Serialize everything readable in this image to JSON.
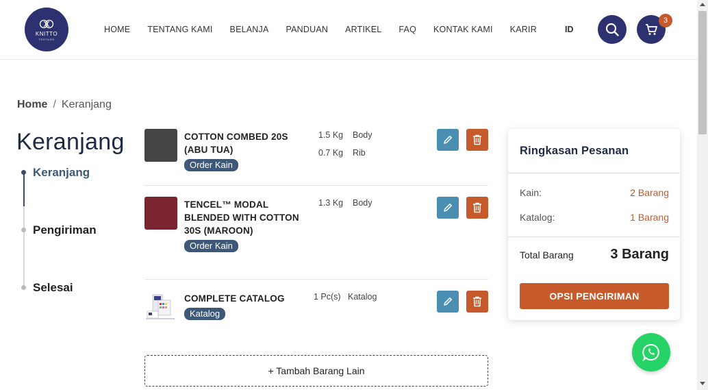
{
  "brand": {
    "name": "KNITTO",
    "sub": "TEXTILES",
    "color": "#2e3170"
  },
  "nav": [
    "HOME",
    "TENTANG KAMI",
    "BELANJA",
    "PANDUAN",
    "ARTIKEL",
    "FAQ",
    "KONTAK KAMI",
    "KARIR"
  ],
  "lang": "ID",
  "cart": {
    "count": "3"
  },
  "breadcrumb": {
    "home": "Home",
    "sep": "/",
    "current": "Keranjang"
  },
  "page_title": "Keranjang",
  "steps": [
    "Keranjang",
    "Pengiriman",
    "Selesai"
  ],
  "items": [
    {
      "name": "COTTON COMBED 20S (ABU TUA)",
      "tag": "Order Kain",
      "swatch": "#444447",
      "qty": [
        {
          "amount": "1.5 Kg",
          "part": "Body"
        },
        {
          "amount": "0.7 Kg",
          "part": "Rib"
        }
      ]
    },
    {
      "name": "TENCEL™ MODAL BLENDED WITH COTTON 30S (MAROON)",
      "tag": "Order Kain",
      "swatch": "#7a2530",
      "qty": [
        {
          "amount": "1.3 Kg",
          "part": "Body"
        }
      ]
    },
    {
      "name": "COMPLETE CATALOG",
      "tag": "Katalog",
      "swatch": "catalog-image",
      "qty": [
        {
          "amount": "1 Pc(s)",
          "part": "Katalog"
        }
      ]
    }
  ],
  "add_more": "+ Tambah Barang Lain",
  "summary": {
    "title": "Ringkasan Pesanan",
    "rows": [
      {
        "label": "Kain:",
        "value": "2 Barang"
      },
      {
        "label": "Katalog:",
        "value": "1 Barang"
      }
    ],
    "total_label": "Total Barang",
    "total_value": "3 Barang",
    "cta": "OPSI PENGIRIMAN"
  },
  "colors": {
    "accent": "#c65a2a",
    "tag": "#3d5878",
    "edit": "#4a8fb2",
    "whatsapp": "#25d366"
  }
}
